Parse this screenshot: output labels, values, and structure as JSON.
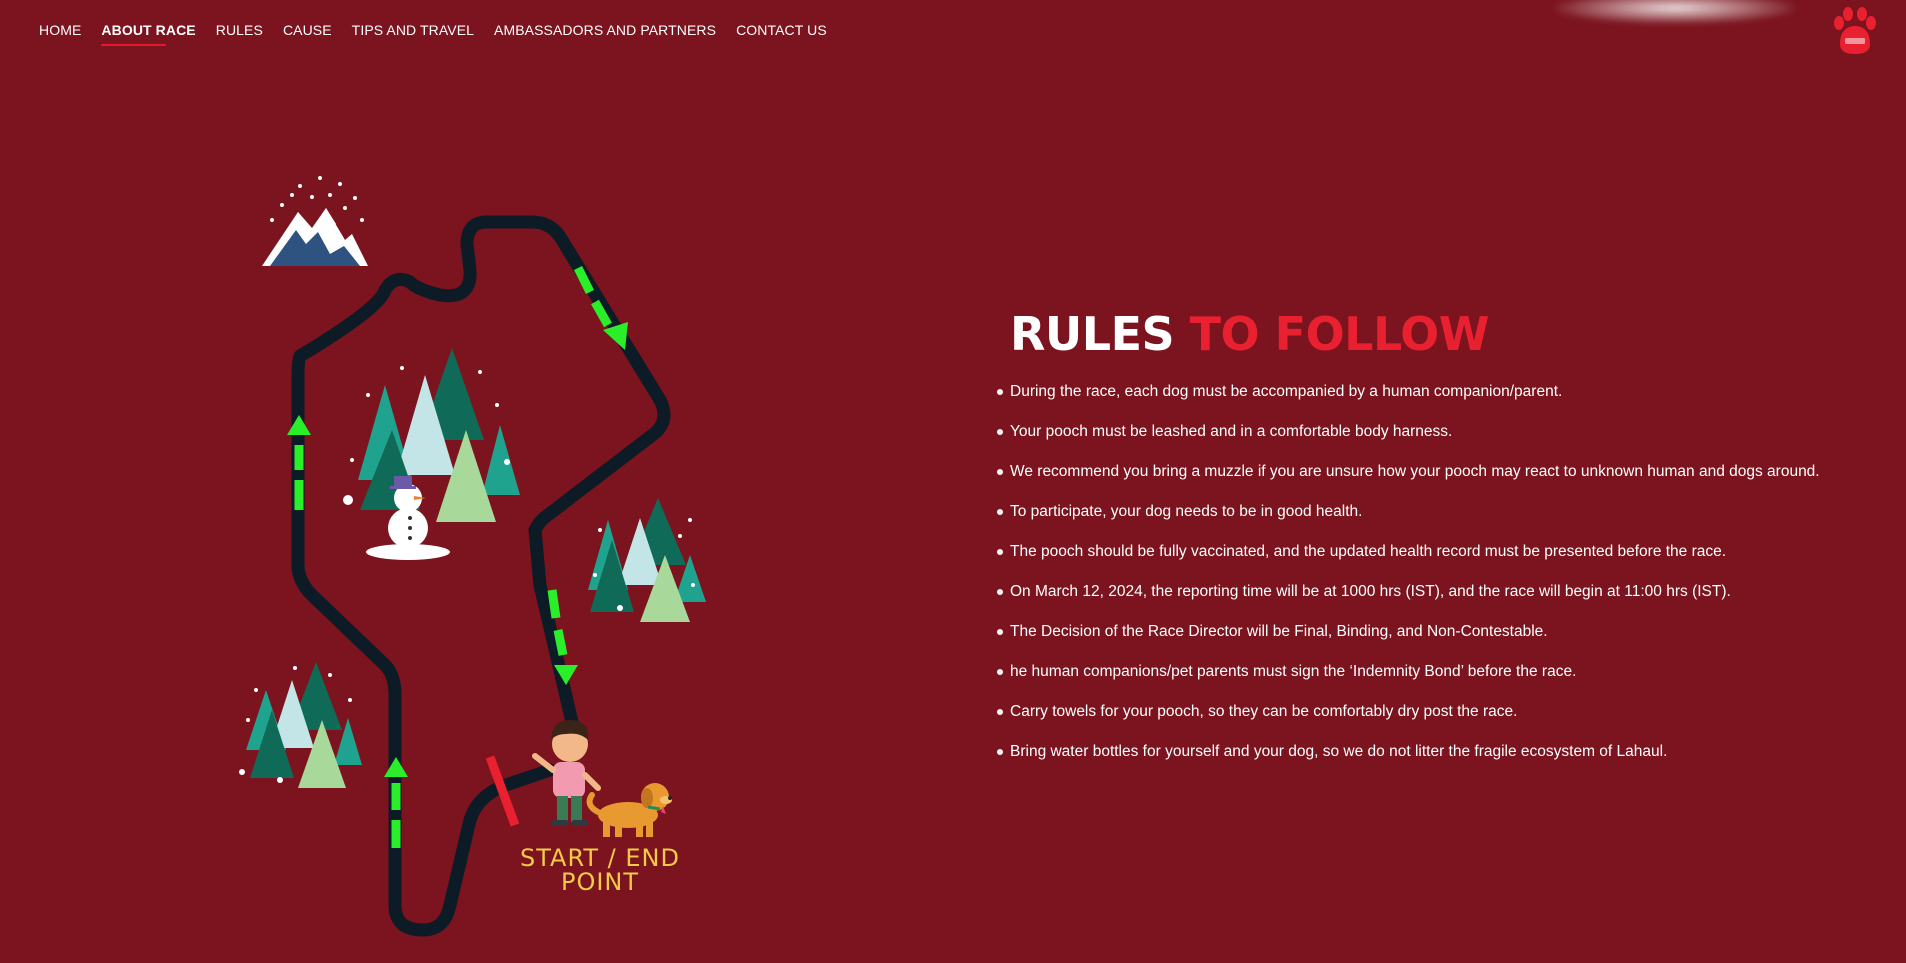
{
  "nav": {
    "items": [
      {
        "label": "HOME",
        "active": false
      },
      {
        "label": "ABOUT RACE",
        "active": true
      },
      {
        "label": "RULES",
        "active": false
      },
      {
        "label": "CAUSE",
        "active": false
      },
      {
        "label": "TIPS AND TRAVEL",
        "active": false
      },
      {
        "label": "AMBASSADORS AND PARTNERS",
        "active": false
      },
      {
        "label": "CONTACT US",
        "active": false
      }
    ],
    "logo_icon": "paw-logo-icon"
  },
  "map": {
    "start_label": "START / END\nPOINT",
    "route_color": "#0d1b27",
    "arrow_color": "#2bee2b",
    "start_line_color": "#e8202f"
  },
  "rules": {
    "title_white": "RULES",
    "title_red": "TO FOLLOW",
    "items": [
      "During the race, each dog must be accompanied by a human companion/parent.",
      "Your pooch must be leashed and in a comfortable body harness.",
      "We recommend you bring a muzzle if you are unsure how your pooch may react to unknown human and dogs around.",
      "To participate, your dog needs to be in good health.",
      "The pooch should be fully vaccinated, and the updated health record must be presented before the race.",
      "On March 12, 2024, the reporting time will be at 1000 hrs (IST), and the race will begin at 11:00 hrs (IST).",
      "The Decision of the Race Director will be Final, Binding, and Non-Contestable.",
      "he human companions/pet parents must sign the ‘Indemnity Bond’ before the race.",
      "Carry towels for your pooch, so they can be comfortably dry post the race.",
      "Bring water bottles for yourself and your dog, so we do not litter the fragile ecosystem of Lahaul."
    ]
  },
  "colors": {
    "background": "#7b141e",
    "accent_red": "#e8202f",
    "label_yellow": "#f3cb47"
  }
}
